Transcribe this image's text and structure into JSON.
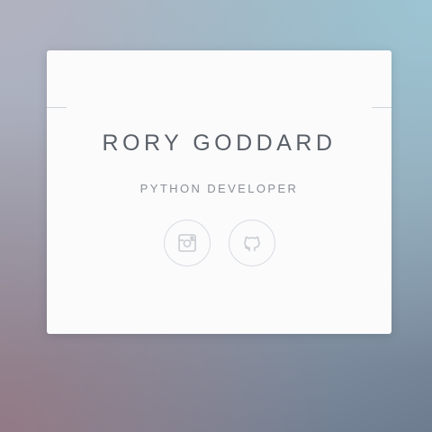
{
  "profile": {
    "name": "RORY GODDARD",
    "role": "PYTHON DEVELOPER"
  },
  "social_links": [
    {
      "icon": "instagram-icon"
    },
    {
      "icon": "github-icon"
    }
  ],
  "colors": {
    "card_background": "#fbfbfc",
    "name_text": "#5a6068",
    "subtitle_text": "#8a8f96",
    "icon_stroke": "#c9cdd2"
  }
}
